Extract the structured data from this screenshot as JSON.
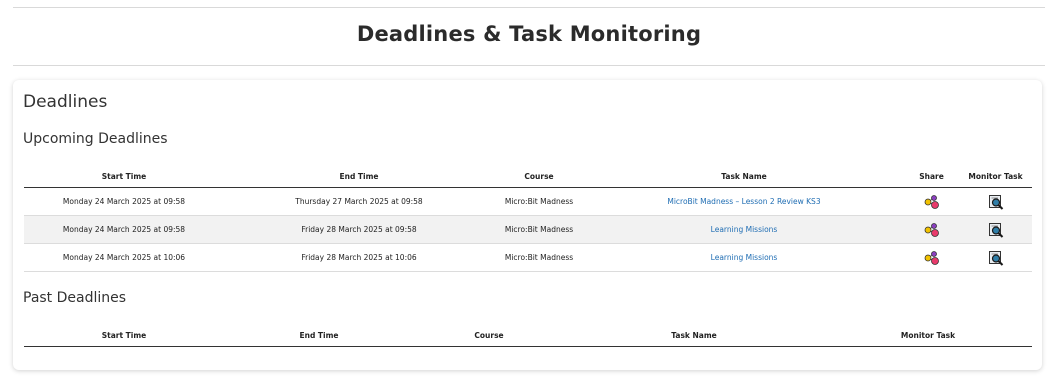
{
  "page": {
    "title": "Deadlines & Task Monitoring"
  },
  "card": {
    "title": "Deadlines"
  },
  "upcoming": {
    "title": "Upcoming Deadlines",
    "headers": [
      "Start Time",
      "End Time",
      "Course",
      "Task Name",
      "Share",
      "Monitor Task"
    ],
    "rows": [
      {
        "start": "Monday 24 March 2025 at 09:58",
        "end": "Thursday 27 March 2025 at 09:58",
        "course": "Micro:Bit Madness",
        "task": "MicroBit Madness – Lesson 2 Review KS3",
        "share_icon": "share-icon",
        "monitor_icon": "monitor-task-icon"
      },
      {
        "start": "Monday 24 March 2025 at 09:58",
        "end": "Friday 28 March 2025 at 09:58",
        "course": "Micro:Bit Madness",
        "task": "Learning Missions",
        "share_icon": "share-icon",
        "monitor_icon": "monitor-task-icon"
      },
      {
        "start": "Monday 24 March 2025 at 10:06",
        "end": "Friday 28 March 2025 at 10:06",
        "course": "Micro:Bit Madness",
        "task": "Learning Missions",
        "share_icon": "share-icon",
        "monitor_icon": "monitor-task-icon"
      }
    ]
  },
  "past": {
    "title": "Past Deadlines",
    "headers": [
      "Start Time",
      "End Time",
      "Course",
      "Task Name",
      "Monitor Task"
    ]
  },
  "colors": {
    "link": "#1f6db3",
    "row_alt": "#f2f2f2",
    "rule": "#333333"
  }
}
